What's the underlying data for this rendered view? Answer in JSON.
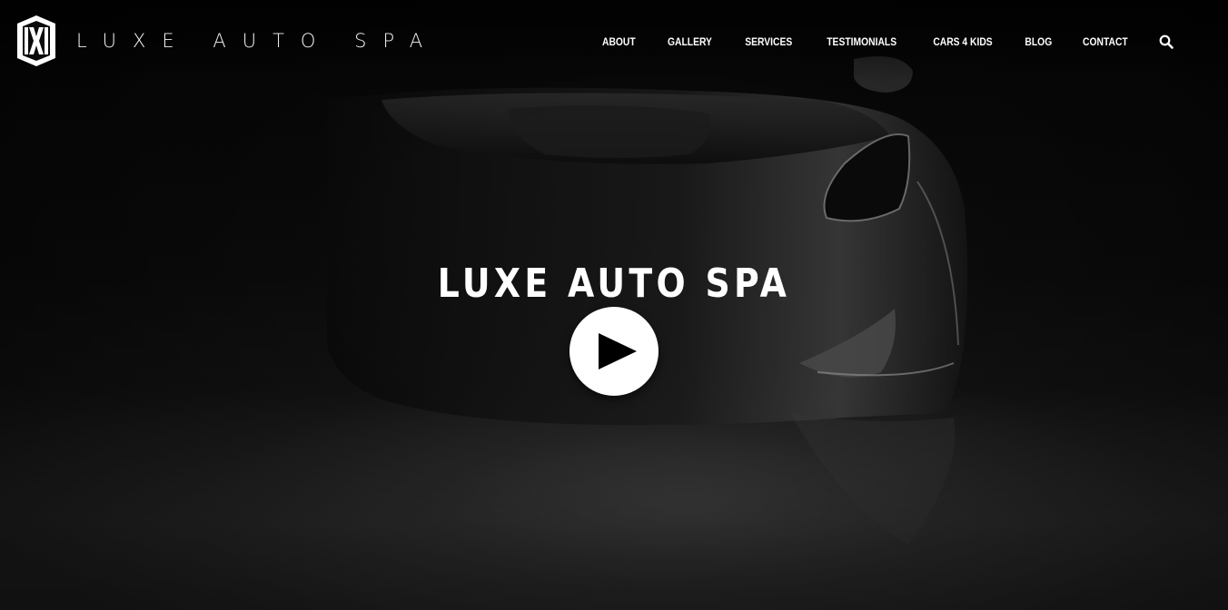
{
  "brand": {
    "name": "LUXE AUTO SPA",
    "logo_icon": "lx-shield-logo-icon"
  },
  "nav": {
    "items": [
      {
        "label": "ABOUT"
      },
      {
        "label": "GALLERY"
      },
      {
        "label": "SERVICES"
      },
      {
        "label": "TESTIMONIALS"
      },
      {
        "label": "CARS 4 KIDS"
      },
      {
        "label": "BLOG"
      },
      {
        "label": "CONTACT"
      }
    ],
    "search_icon": "search-icon"
  },
  "hero": {
    "title": "LUXE AUTO SPA",
    "play_icon": "play-icon"
  },
  "colors": {
    "background": "#050505",
    "text": "#ffffff",
    "play_button": "#ffffff"
  }
}
